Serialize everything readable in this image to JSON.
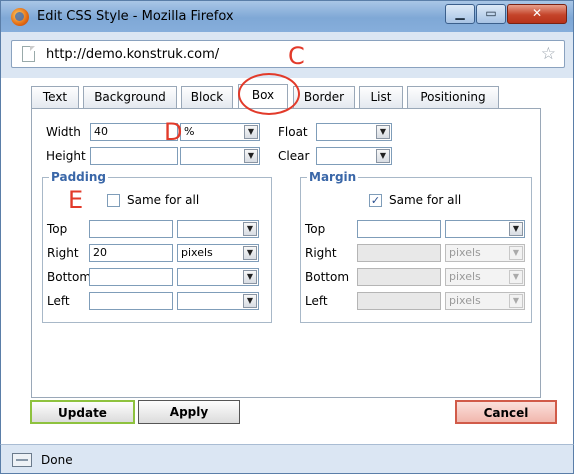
{
  "window": {
    "title": "Edit CSS Style - Mozilla Firefox"
  },
  "browser": {
    "url": "http://demo.konstruk.com/"
  },
  "tabs": [
    "Text",
    "Background",
    "Block",
    "Box",
    "Border",
    "List",
    "Positioning"
  ],
  "active_tab": "Box",
  "box": {
    "width_label": "Width",
    "width_value": "40",
    "width_unit": "%",
    "height_label": "Height",
    "height_value": "",
    "height_unit": "",
    "float_label": "Float",
    "float_value": "",
    "clear_label": "Clear",
    "clear_value": ""
  },
  "padding": {
    "legend": "Padding",
    "same_for_all_label": "Same for all",
    "same_for_all_checked": false,
    "top_label": "Top",
    "top_value": "",
    "top_unit": "",
    "right_label": "Right",
    "right_value": "20",
    "right_unit": "pixels",
    "bottom_label": "Bottom",
    "bottom_value": "",
    "bottom_unit": "",
    "left_label": "Left",
    "left_value": "",
    "left_unit": ""
  },
  "margin": {
    "legend": "Margin",
    "same_for_all_label": "Same for all",
    "same_for_all_checked": true,
    "top_label": "Top",
    "top_value": "",
    "top_unit": "",
    "right_label": "Right",
    "right_unit": "pixels",
    "bottom_label": "Bottom",
    "bottom_unit": "pixels",
    "left_label": "Left",
    "left_unit": "pixels"
  },
  "buttons": {
    "update": "Update",
    "apply": "Apply",
    "cancel": "Cancel"
  },
  "annotations": {
    "c": "C",
    "d": "D",
    "e": "E"
  },
  "status": {
    "text": "Done"
  },
  "colors": {
    "annotation_red": "#e23a2a",
    "legend_blue": "#3a67a8"
  }
}
